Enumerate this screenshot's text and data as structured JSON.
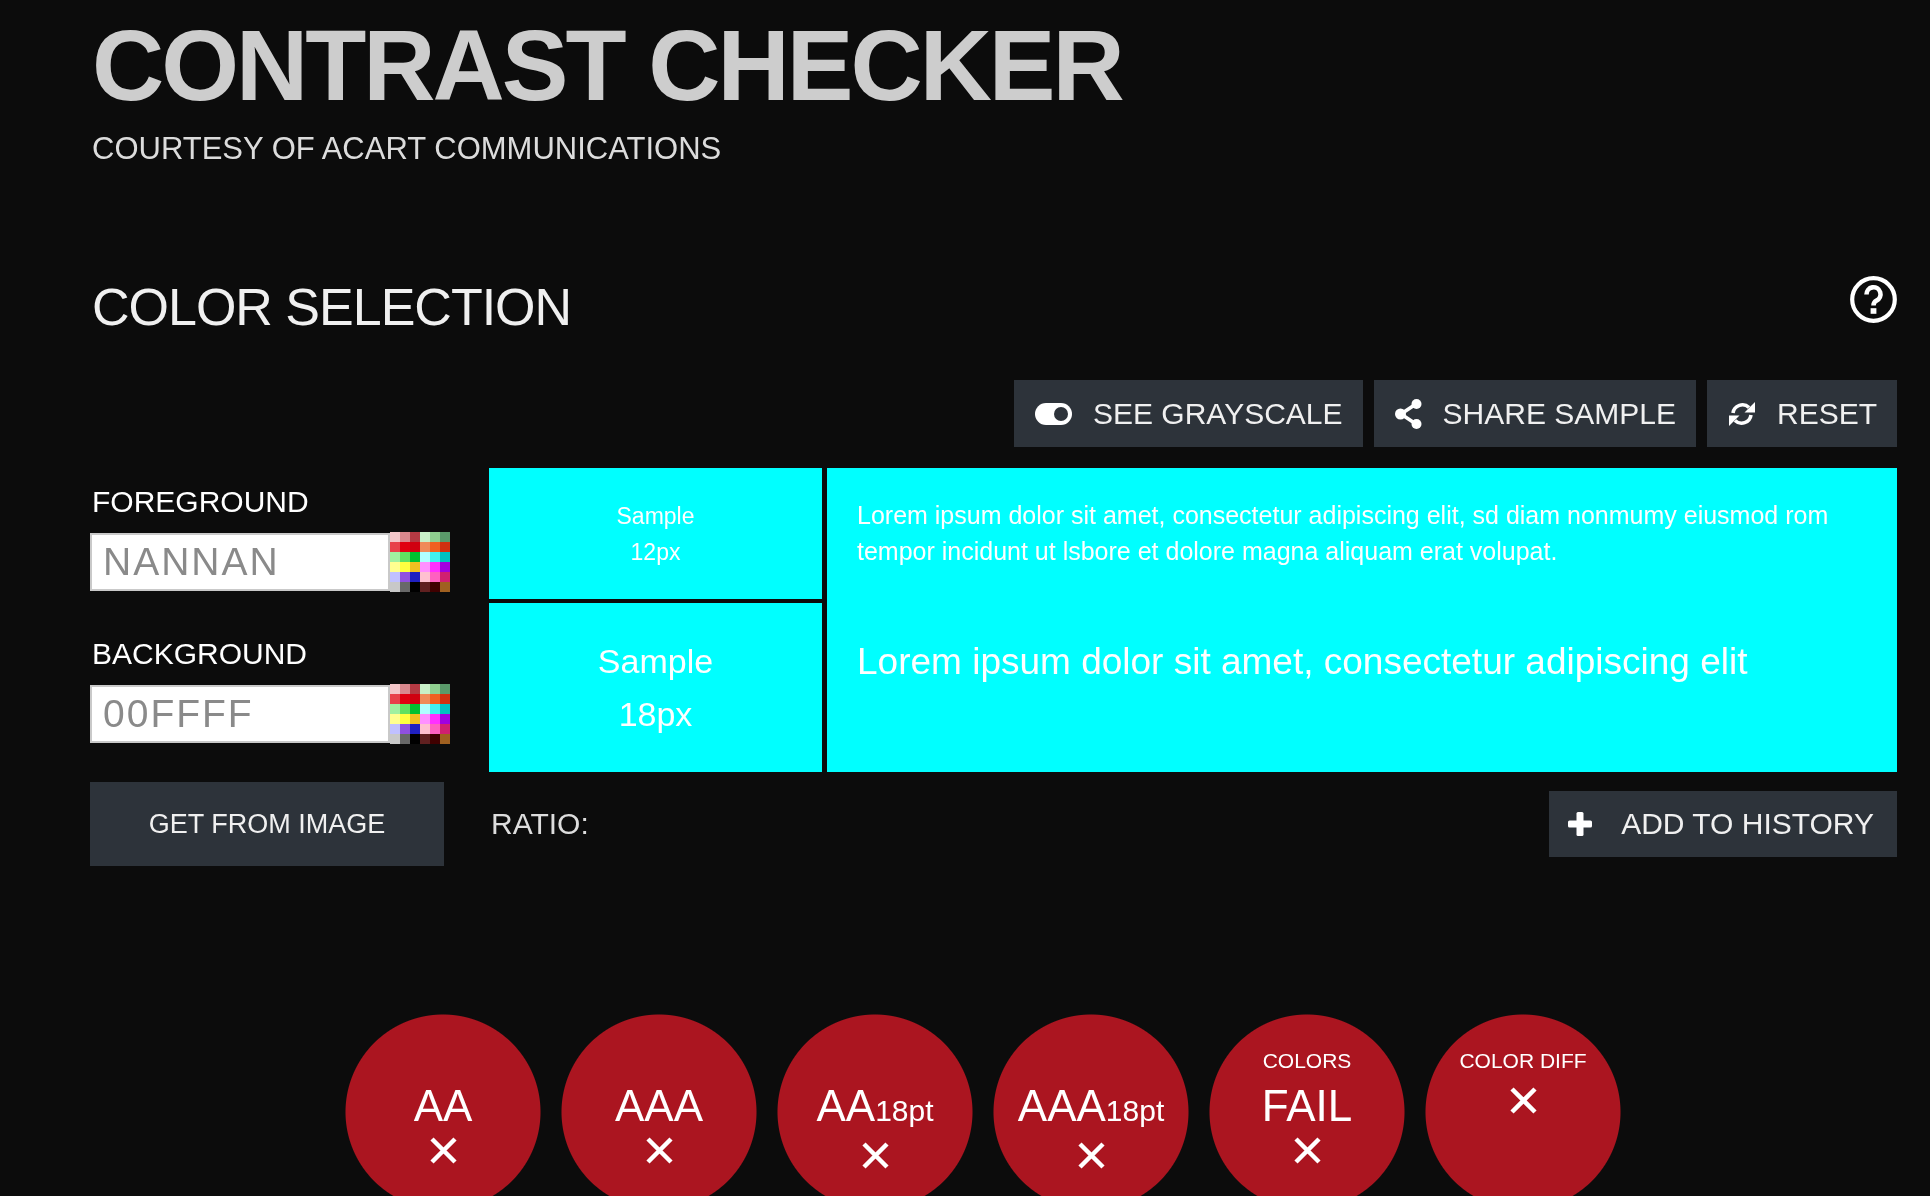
{
  "header": {
    "title": "CONTRAST CHECKER",
    "subtitle": "COURTESY OF ACART COMMUNICATIONS"
  },
  "color_selection": {
    "heading": "COLOR SELECTION",
    "toolbar": [
      {
        "kind": "grayscale",
        "label": "SEE GRAYSCALE"
      },
      {
        "kind": "share",
        "label": "SHARE SAMPLE"
      },
      {
        "kind": "reset",
        "label": "RESET"
      }
    ],
    "fields": [
      {
        "label": "FOREGROUND",
        "value": "NANNAN"
      },
      {
        "label": "BACKGROUND",
        "value": "00FFFF"
      }
    ],
    "get_from_image": {
      "label": "GET FROM IMAGE"
    },
    "preview": {
      "samples": [
        {
          "label": "Sample 12px",
          "text": "Lorem ipsum dolor sit amet, consectetur adipiscing elit, sd diam nonmumy eiusmod rom tempor incidunt ut lsbore et dolore magna aliquam erat volupat."
        },
        {
          "label": "Sample 18px",
          "text": "Lorem ipsum dolor sit amet, consectetur adipiscing elit"
        }
      ]
    },
    "ratio": {
      "label": "RATIO:"
    },
    "add_to_history": {
      "label": "ADD TO HISTORY"
    }
  },
  "results": [
    {
      "label": "AA",
      "passed": false
    },
    {
      "label": "AAA",
      "passed": false
    },
    {
      "label": "AA",
      "size": "18pt",
      "passed": false
    },
    {
      "label": "AAA",
      "size": "18pt",
      "passed": false
    },
    {
      "caption": "COLORS",
      "label": "FAIL",
      "passed": false
    },
    {
      "caption": "COLOR DIFF",
      "passed": false
    }
  ]
}
